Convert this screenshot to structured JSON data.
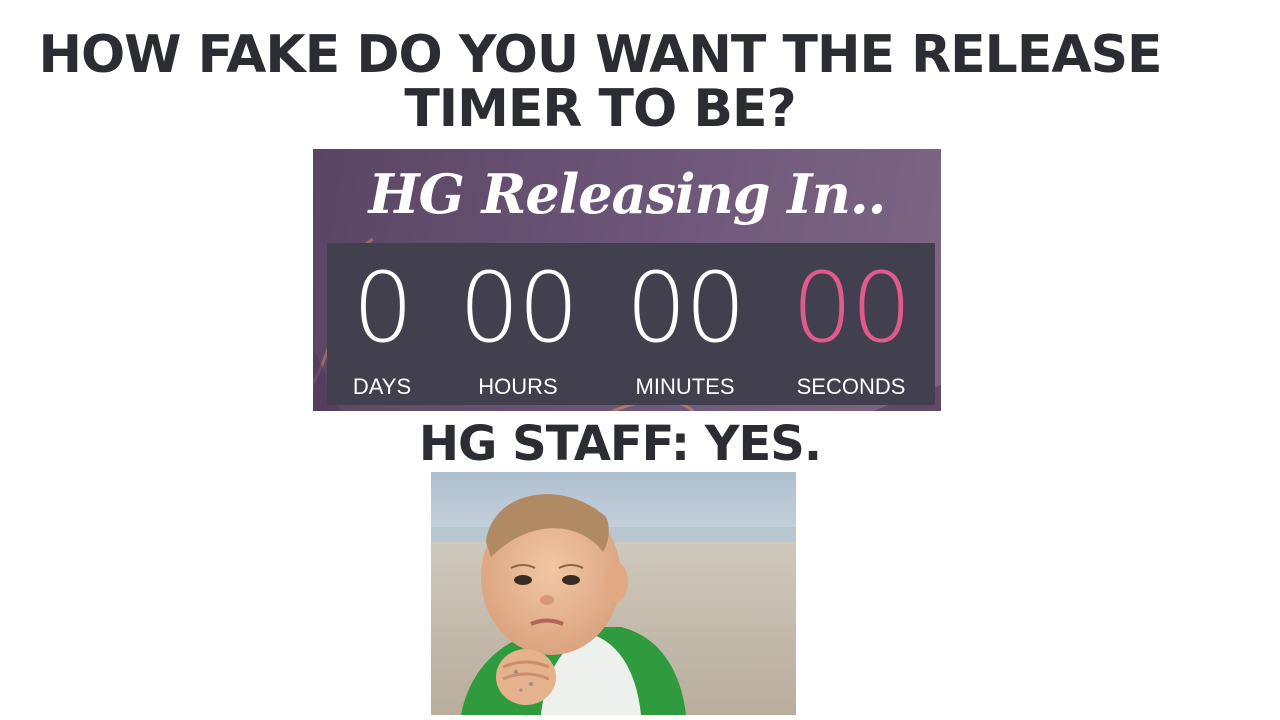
{
  "heading": {
    "line1": "HOW FAKE DO YOU WANT THE RELEASE",
    "line2": "TIMER TO BE?"
  },
  "banner": {
    "title": "HG Releasing In..",
    "units": [
      {
        "value": "0",
        "label": "DAYS"
      },
      {
        "value": "00",
        "label": "HOURS"
      },
      {
        "value": "00",
        "label": "MINUTES"
      },
      {
        "value": "00",
        "label": "SECONDS"
      }
    ],
    "colors": {
      "background": "#6e5779",
      "timer_box": "#423f4f",
      "seconds_accent": "#e05a8e"
    }
  },
  "answer": "HG STAFF: YES.",
  "photo": {
    "subject": "success-kid-photo"
  }
}
